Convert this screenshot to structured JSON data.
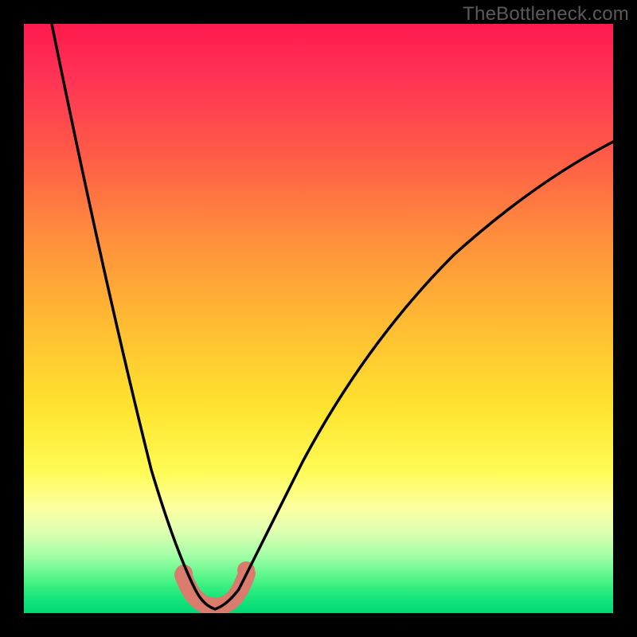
{
  "watermark": "TheBottleneck.com",
  "chart_data": {
    "type": "line",
    "title": "",
    "xlabel": "",
    "ylabel": "",
    "xlim": [
      0,
      100
    ],
    "ylim": [
      0,
      100
    ],
    "series": [
      {
        "name": "bottleneck-curve",
        "x": [
          0,
          5,
          10,
          15,
          20,
          23,
          25,
          27,
          29,
          30,
          31,
          33,
          35,
          40,
          45,
          50,
          60,
          70,
          80,
          90,
          100
        ],
        "y": [
          100,
          82,
          64,
          46,
          28,
          14,
          6,
          2,
          0,
          0,
          0,
          2,
          6,
          18,
          30,
          40,
          55,
          66,
          74,
          80,
          84
        ]
      }
    ],
    "highlight": {
      "name": "optimal-range",
      "x": [
        26,
        28,
        30,
        32,
        34
      ],
      "y": [
        3,
        0.5,
        0,
        0.5,
        3
      ]
    }
  }
}
